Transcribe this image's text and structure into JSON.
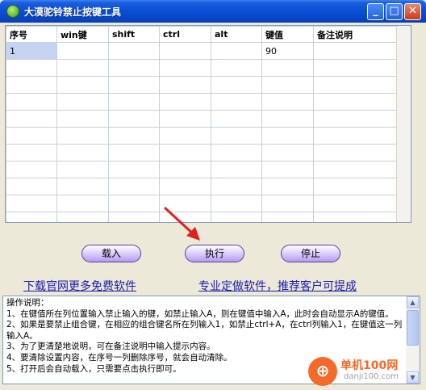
{
  "window": {
    "title": "大漠驼铃禁止按键工具"
  },
  "grid": {
    "columns": [
      "序号",
      "win键",
      "shift",
      "ctrl",
      "alt",
      "键值",
      "备注说明"
    ],
    "rows": [
      [
        "1",
        "",
        "",
        "",
        "",
        "90",
        ""
      ],
      [
        "",
        "",
        "",
        "",
        "",
        "",
        ""
      ],
      [
        "",
        "",
        "",
        "",
        "",
        "",
        ""
      ],
      [
        "",
        "",
        "",
        "",
        "",
        "",
        ""
      ],
      [
        "",
        "",
        "",
        "",
        "",
        "",
        ""
      ],
      [
        "",
        "",
        "",
        "",
        "",
        "",
        ""
      ],
      [
        "",
        "",
        "",
        "",
        "",
        "",
        ""
      ],
      [
        "",
        "",
        "",
        "",
        "",
        "",
        ""
      ],
      [
        "",
        "",
        "",
        "",
        "",
        "",
        ""
      ],
      [
        "",
        "",
        "",
        "",
        "",
        "",
        ""
      ],
      [
        "",
        "",
        "",
        "",
        "",
        "",
        ""
      ]
    ]
  },
  "buttons": {
    "load": "载入",
    "execute": "执行",
    "stop": "停止"
  },
  "links": {
    "download": "下载官网更多免费软件",
    "custom": "专业定做软件，推荐客户可提成"
  },
  "help": {
    "lines": [
      "操作说明：",
      "1、在键值所在列位置输入禁止输入的键，如禁止输入A，则在键值中输入A，此时会自动显示A的键值。",
      "2、如果是要禁止组合键，在相应的组合键名所在列输入1，如禁止ctrl+A，在ctrl列输入1，在键值这一列输入A。",
      "3、为了更清楚地说明，可在备注说明中输入提示内容。",
      "4、要清除设置内容，在序号一列删除序号，就会自动清除。",
      "5、打开后会自动载入，只需要点击执行即可。"
    ]
  },
  "watermark": {
    "name": "单机100网",
    "url": "danji100.com"
  },
  "colors": {
    "title_bar": "#0a52d8",
    "button_accent": "#b69bf0",
    "link": "#1a1ab0",
    "arrow": "#e02020"
  }
}
